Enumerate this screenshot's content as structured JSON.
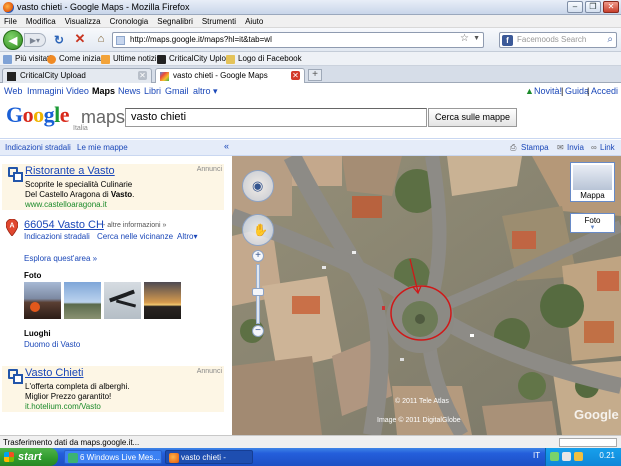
{
  "window": {
    "title": "vasto chieti - Google Maps - Mozilla Firefox"
  },
  "menu": [
    "File",
    "Modifica",
    "Visualizza",
    "Cronologia",
    "Segnalibri",
    "Strumenti",
    "Aiuto"
  ],
  "nav": {
    "url": "http://maps.google.it/maps?hl=it&tab=wl",
    "search_placeholder": "Facemoods Search"
  },
  "bookmarks": [
    "Più visitati",
    "Come iniziare",
    "Ultime notizie",
    "CriticalCity Upload",
    "Logo di Facebook"
  ],
  "tabs": [
    {
      "label": "CriticalCity Upload"
    },
    {
      "label": "vasto chieti - Google Maps"
    }
  ],
  "gbar": {
    "left": [
      "Web",
      "Immagini",
      "Video",
      "Maps",
      "News",
      "Libri",
      "Gmail",
      "altro ▾"
    ],
    "right": {
      "novita": "Novità!",
      "guida": "Guida",
      "accedi": "Accedi"
    }
  },
  "header": {
    "logo_maps": "maps",
    "logo_sub": "Italia",
    "query": "vasto chieti",
    "search_button": "Cerca sulle mappe"
  },
  "leftnav": {
    "directions": "Indicazioni stradali",
    "my_maps": "Le mie mappe",
    "collapse": "«"
  },
  "ad1": {
    "label": "Annunci",
    "title": "Ristorante a Vasto",
    "line1": "Scoprite le specialità Culinarie",
    "line2": "Del Castello Aragona di Vasto.",
    "url": "www.castelloaragona.it"
  },
  "result": {
    "title": "66054 Vasto CH",
    "more": "- altre informazioni »",
    "links": [
      "Indicazioni stradali",
      "Cerca nelle vicinanze",
      "Altro▾"
    ],
    "explore": "Esplora quest'area »",
    "foto_label": "Foto",
    "luoghi_label": "Luoghi",
    "place": "Duomo di Vasto"
  },
  "ad2": {
    "label": "Annunci",
    "title": "Vasto Chieti",
    "line1": "L'offerta completa di alberghi.",
    "line2": "Miglior Prezzo garantito!",
    "url": "it.hotelium.com/Vasto"
  },
  "maptop": {
    "print": "Stampa",
    "email": "Invia",
    "link": "Link"
  },
  "map": {
    "type_mappa": "Mappa",
    "type_foto": "Foto",
    "copyright1": "© 2011 Tele Atlas",
    "copyright2": "Image © 2011 DigitalGlobe",
    "watermark": "Google"
  },
  "status": {
    "text": "Trasferimento dati da maps.google.it..."
  },
  "taskbar": {
    "start": "start",
    "task1": "6 Windows Live Mes...",
    "task2": "vasto chieti - Google ...",
    "lang": "IT",
    "clock": "0.21"
  },
  "colors": {
    "link": "#1a47b8",
    "url_green": "#1b8a2a",
    "ad_bg": "#fdf6e5",
    "annotation_red": "#d01818"
  }
}
